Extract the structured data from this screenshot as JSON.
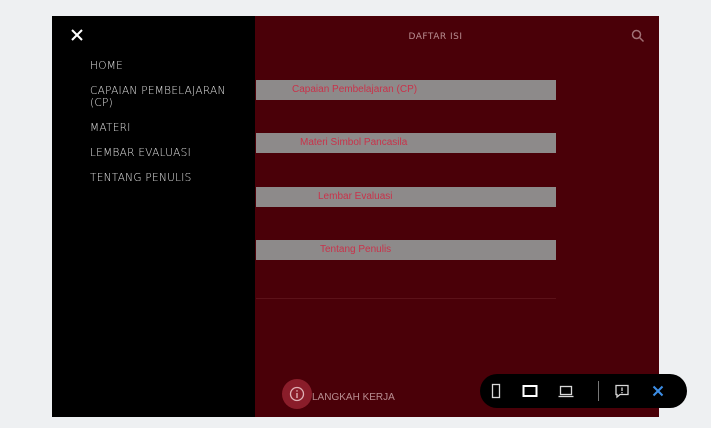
{
  "header": {
    "title": "DAFTAR ISI",
    "search_icon": "search-icon"
  },
  "drawer": {
    "close_icon": "close-icon",
    "items": [
      "HOME",
      "CAPAIAN PEMBELAJARAN (CP)",
      "MATERI",
      "LEMBAR EVALUASI",
      "TENTANG PENULIS"
    ]
  },
  "buttons": {
    "cp": "Capaian Pembelajaran (CP)",
    "materi": "Materi Simbol Pancasila",
    "evaluasi": "Lembar Evaluasi",
    "penulis": "Tentang Penulis"
  },
  "bottom": {
    "label": "LANGKAH KERJA",
    "info_icon": "info-icon"
  },
  "toolbar": {
    "icons": [
      "phone-portrait-icon",
      "tablet-landscape-icon",
      "laptop-icon",
      "feedback-icon",
      "close-icon"
    ]
  },
  "colors": {
    "background": "#4a0008",
    "drawer": "#000000",
    "button_bg": "#8d8a8a",
    "button_text": "#c9324a",
    "accent": "#3d8ee6"
  }
}
